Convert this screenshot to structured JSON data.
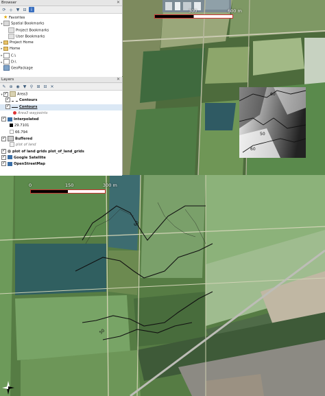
{
  "browser": {
    "title": "Browser",
    "items": [
      {
        "label": "Favorites",
        "icon": "star-icon",
        "arrow": ""
      },
      {
        "label": "Spatial Bookmarks",
        "icon": "bookmark-icon",
        "arrow": "v"
      },
      {
        "label": "Project Bookmarks",
        "icon": "bookmark-icon",
        "arrow": ""
      },
      {
        "label": "User Bookmarks",
        "icon": "bookmark-icon",
        "arrow": ""
      },
      {
        "label": "Project Home",
        "icon": "folder-icon",
        "arrow": ">"
      },
      {
        "label": "Home",
        "icon": "folder-icon",
        "arrow": ">"
      },
      {
        "label": "C:\\",
        "icon": "drive-icon",
        "arrow": ">"
      },
      {
        "label": "D:\\",
        "icon": "drive-icon",
        "arrow": ">"
      },
      {
        "label": "GeoPackage",
        "icon": "geopackage-icon",
        "arrow": ""
      }
    ]
  },
  "layers": {
    "title": "Layers",
    "group": "Area3",
    "items": [
      {
        "label": "Contours",
        "style": "dash"
      },
      {
        "label": "Contours",
        "style": "bold"
      },
      {
        "label": "Area3 waypoints",
        "style": "italic-point"
      }
    ],
    "interpolated": {
      "label": "Interpolated",
      "max": "29.7101",
      "min": "66.794"
    },
    "buffered": {
      "label": "Buffered",
      "sub": "plot of land"
    },
    "plot": "plot of land grids plot_of_land_grids",
    "google": "Google Satellite",
    "osm": "OpenStreetMap"
  },
  "map": {
    "top_scale": {
      "left": "300",
      "right": "600 m"
    },
    "bottom_scale": {
      "zero": "0",
      "mid": "150",
      "right": "300 m"
    },
    "contour_labels": [
      "60",
      "50",
      "60",
      "55"
    ],
    "inset_labels": [
      "60",
      "50",
      "60"
    ]
  }
}
